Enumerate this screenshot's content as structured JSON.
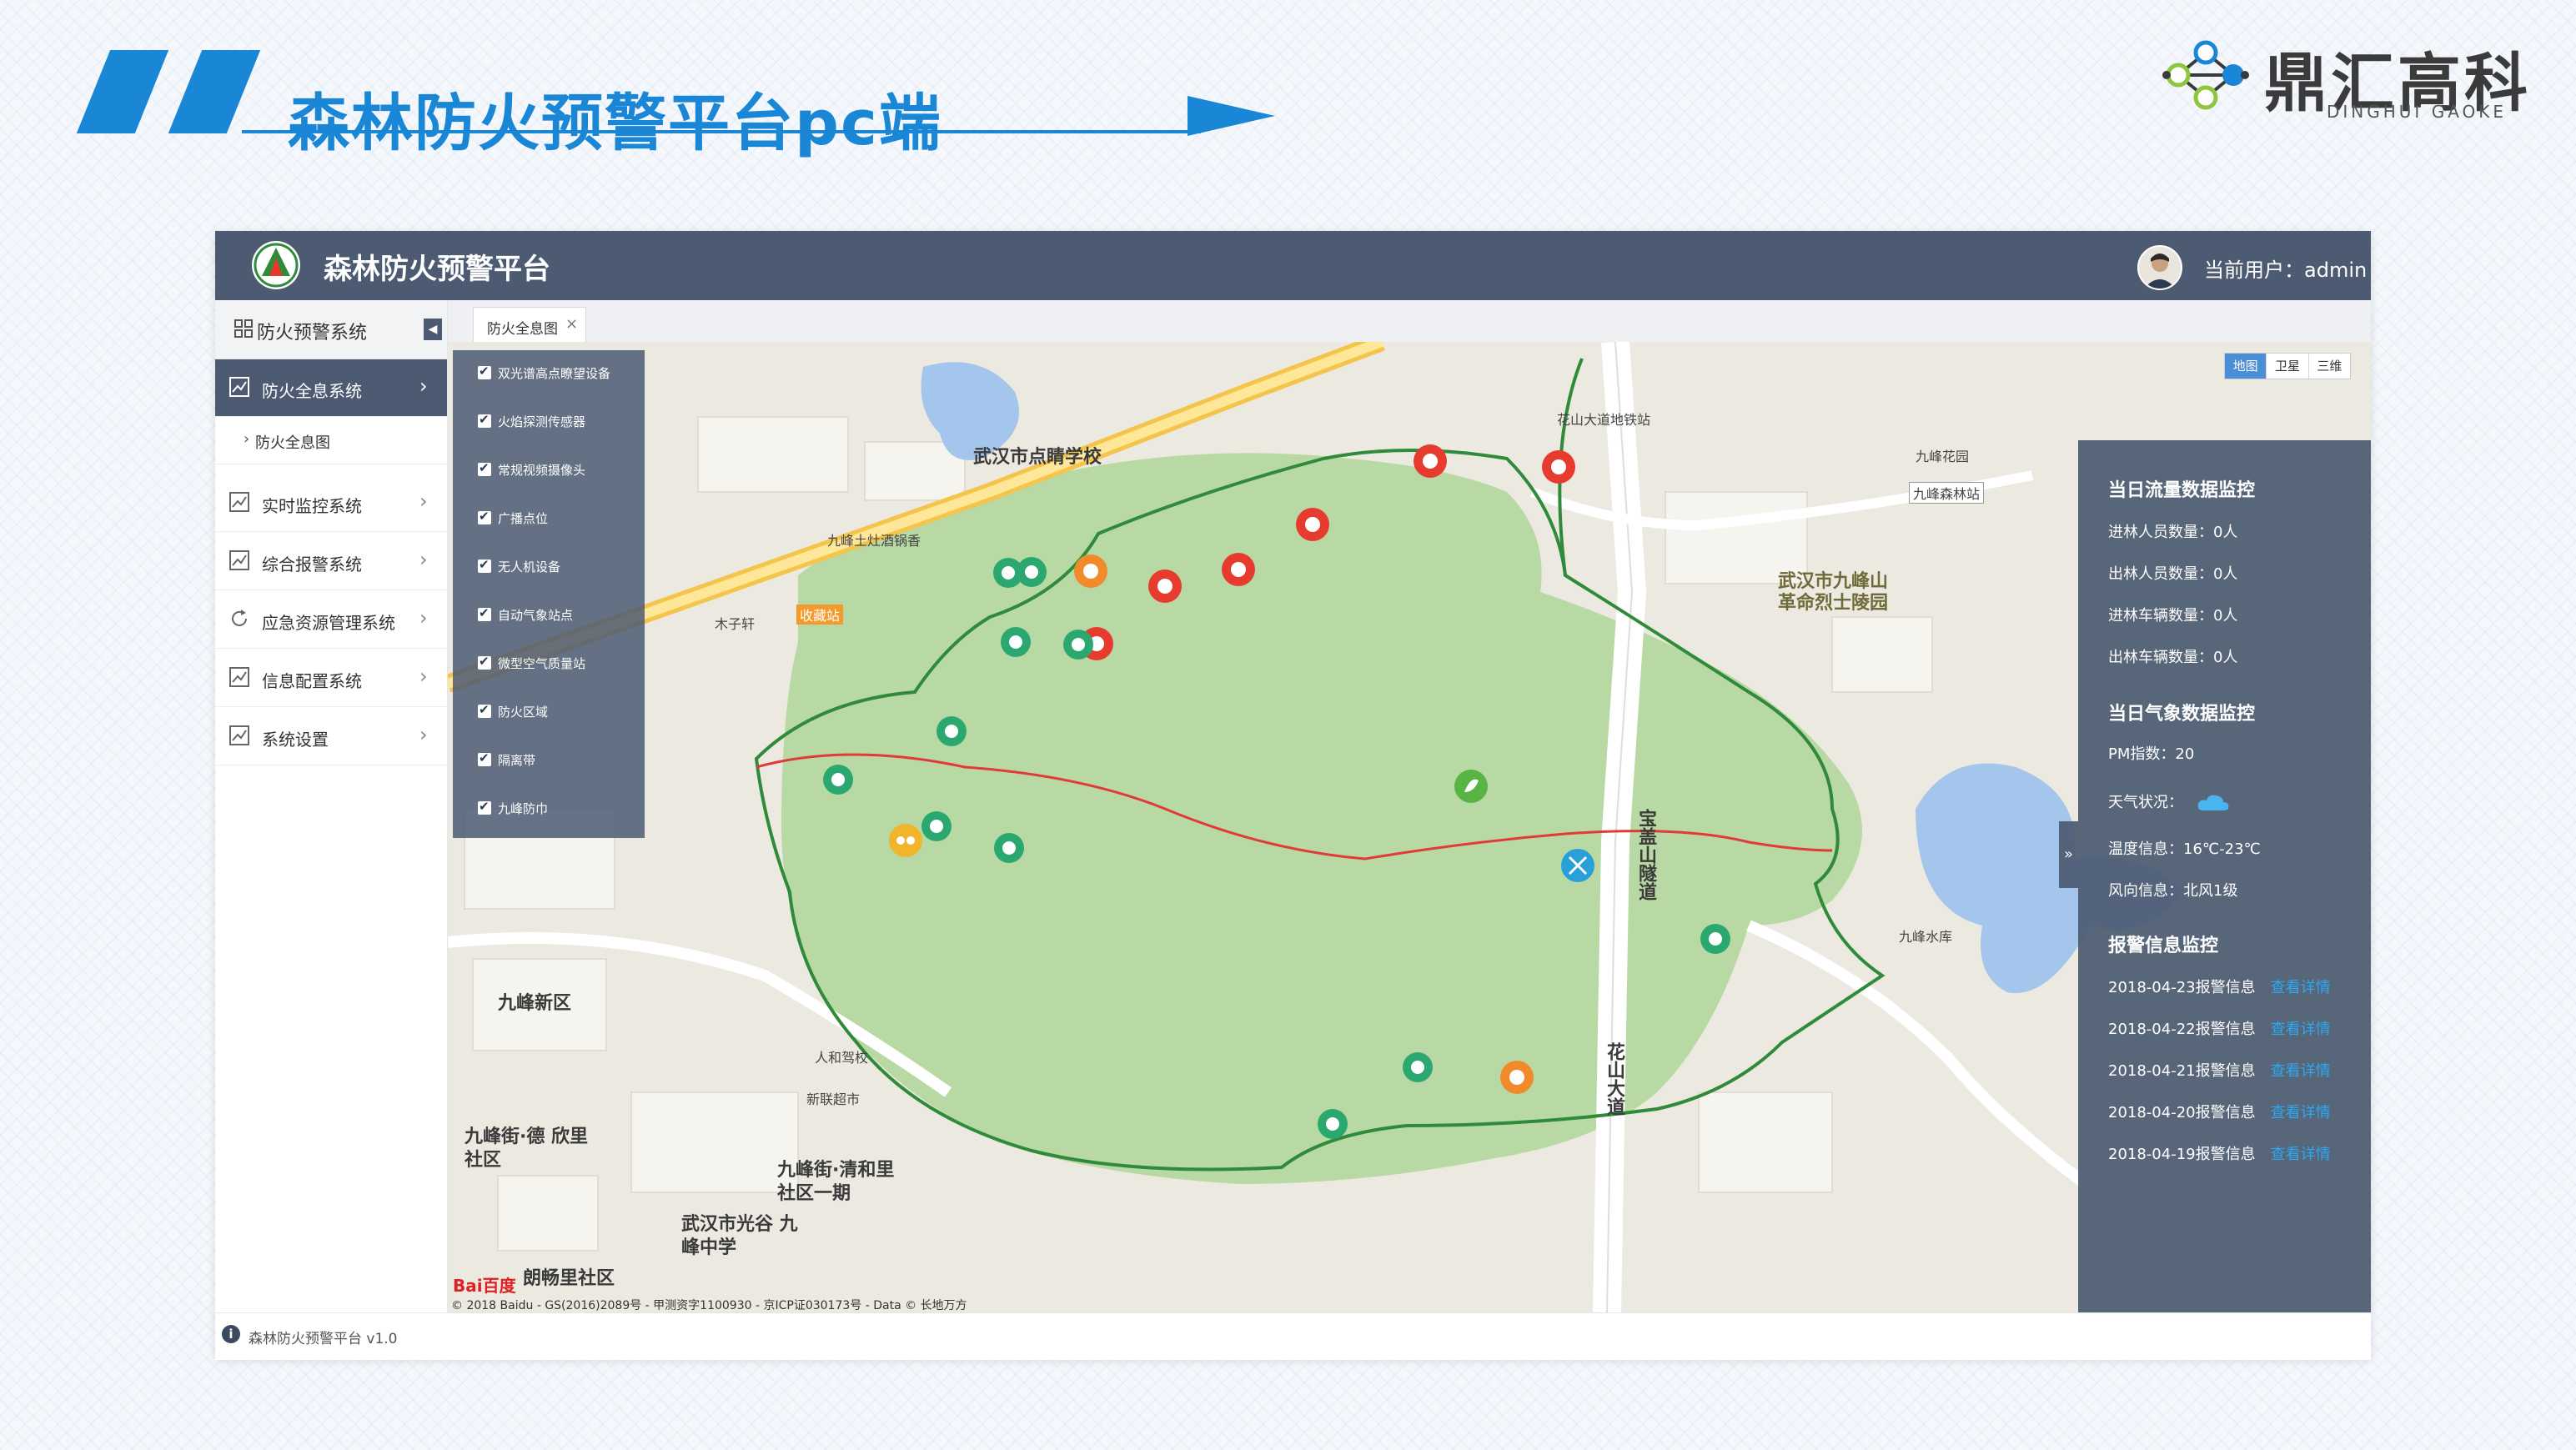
{
  "slide": {
    "title": "森林防火预警平台pc端",
    "brand_name": "鼎汇高科",
    "brand_sub": "DINGHUI GAOKE",
    "accent": "#1a86d6"
  },
  "app": {
    "title": "森林防火预警平台",
    "current_user": "当前用户：admin",
    "footer": "森林防火预警平台 v1.0",
    "colors": {
      "topbar": "#4c5b72",
      "panel": "#4c5b72",
      "link": "#2ba8f0"
    }
  },
  "sidebar": {
    "header": "防火预警系统",
    "items": [
      {
        "label": "防火全息系统",
        "icon": "chart-icon",
        "active": true
      },
      {
        "label": "实时监控系统",
        "icon": "chart-icon"
      },
      {
        "label": "综合报警系统",
        "icon": "chart-icon"
      },
      {
        "label": "应急资源管理系统",
        "icon": "refresh-icon"
      },
      {
        "label": "信息配置系统",
        "icon": "chart-icon"
      },
      {
        "label": "系统设置",
        "icon": "chart-icon"
      }
    ],
    "sub_item": "防火全息图"
  },
  "tabs": [
    {
      "label": "防火全息图"
    }
  ],
  "map": {
    "type_buttons": [
      "地图",
      "卫星",
      "三维"
    ],
    "type_selected": "地图",
    "layers": [
      "双光谱高点瞭望设备",
      "火焰探测传感器",
      "常规视频摄像头",
      "广播点位",
      "无人机设备",
      "自动气象站点",
      "微型空气质量站",
      "防火区域",
      "隔离带",
      "九峰防巾"
    ],
    "labels": {
      "school": "武汉市点睛学校",
      "cemetery": "武汉市九峰山 革命烈士陵园",
      "tunnel": "宝盖山隧道",
      "huashan": "花山大道",
      "jiufeng_new": "九峰新区",
      "jiufeng_de": "九峰街·德 欣里社区",
      "jiufeng_qing": "九峰街·清和里 社区一期",
      "guanggu_school": "武汉市光谷 九峰中学",
      "langchang": "朗畅里社区",
      "jiufeng_tushi": "九峰土灶酒锅香",
      "mutisia": "木子轩",
      "jiufeng_huayuan": "九峰花园",
      "jiufeng_slz": "九峰森林站",
      "shengshan": "花山大道地铁站",
      "shuiku": "九峰水库",
      "renhe": "人和驾校",
      "xinlian": "新联超市",
      "shoucang": "收藏站"
    },
    "credit": "© 2018 Baidu - GS(2016)2089号 - 甲测资字1100930 - 京ICP证030173号 - Data © 长地万方",
    "baidu": "Bai百度"
  },
  "info_panel": {
    "flow_title": "当日流量数据监控",
    "flow": [
      {
        "label": "进林人员数量：",
        "value": "0人"
      },
      {
        "label": "出林人员数量：",
        "value": "0人"
      },
      {
        "label": "进林车辆数量：",
        "value": "0人"
      },
      {
        "label": "出林车辆数量：",
        "value": "0人"
      }
    ],
    "weather_title": "当日气象数据监控",
    "pm_label": "PM指数：",
    "pm_value": "20",
    "weather_label": "天气状况：",
    "weather_icon": "cloud-icon",
    "temp_label": "温度信息：",
    "temp_value": "16℃-23℃",
    "wind_label": "风向信息：",
    "wind_value": "北风1级",
    "alarm_title": "报警信息监控",
    "alarms": [
      {
        "text": "2018-04-23报警信息",
        "link": "查看详情"
      },
      {
        "text": "2018-04-22报警信息",
        "link": "查看详情"
      },
      {
        "text": "2018-04-21报警信息",
        "link": "查看详情"
      },
      {
        "text": "2018-04-20报警信息",
        "link": "查看详情"
      },
      {
        "text": "2018-04-19报警信息",
        "link": "查看详情"
      }
    ]
  }
}
